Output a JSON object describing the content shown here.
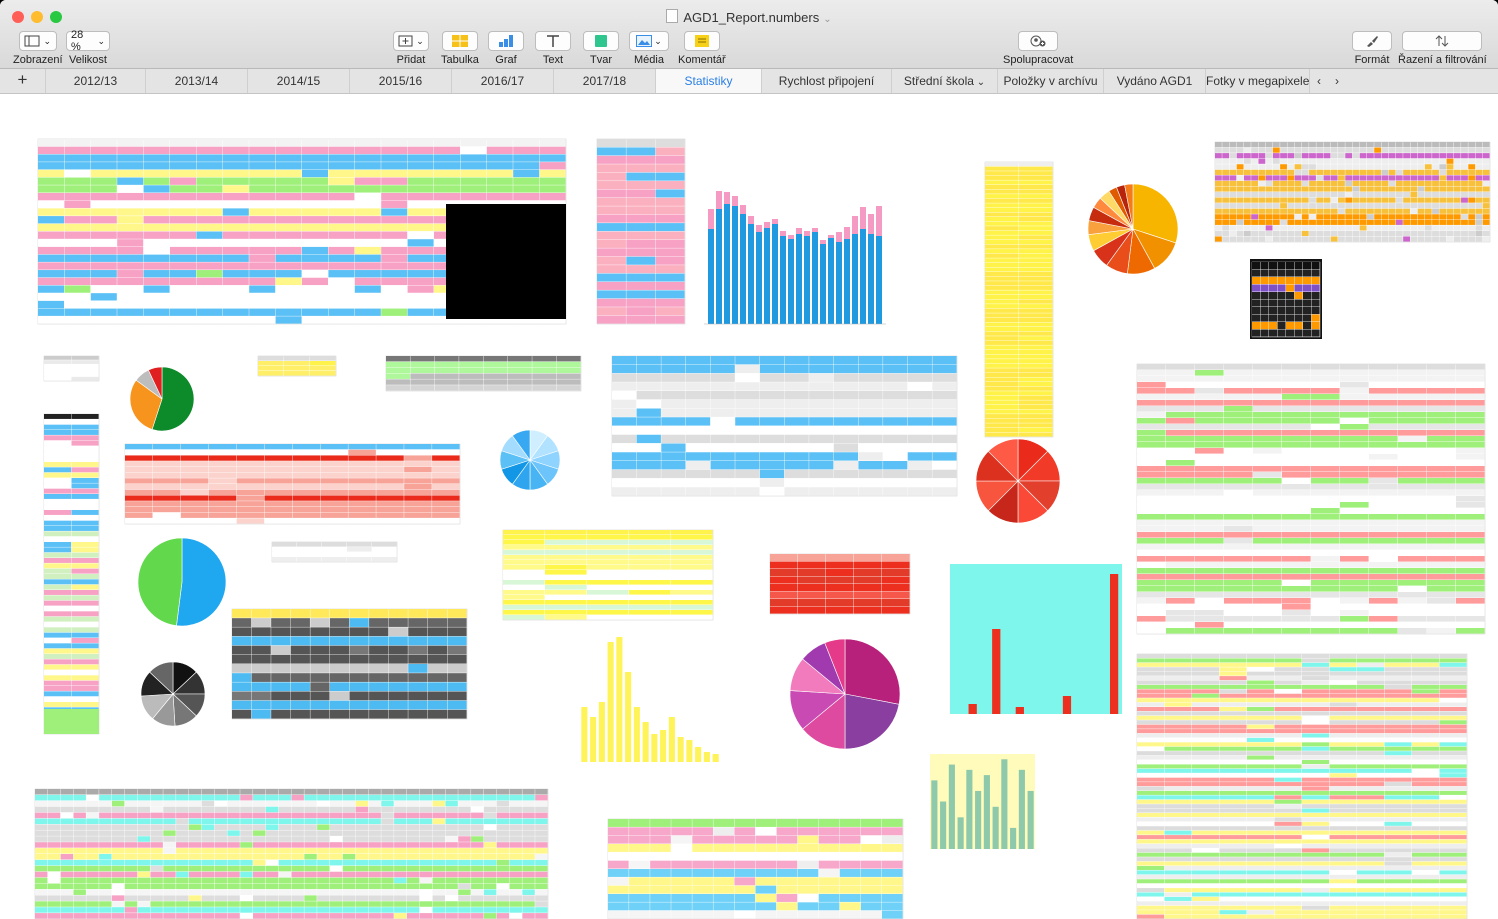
{
  "window": {
    "title": "AGD1_Report.numbers",
    "lights": [
      "#ff5f57",
      "#febc2e",
      "#28c840"
    ]
  },
  "toolbar": {
    "zoom_value": "28 %",
    "view_label": "Zobrazení",
    "size_label": "Velikost",
    "add_label": "Přidat",
    "table_label": "Tabulka",
    "chart_label": "Graf",
    "text_label": "Text",
    "shape_label": "Tvar",
    "media_label": "Média",
    "comment_label": "Komentář",
    "collaborate_label": "Spolupracovat",
    "format_label": "Formát",
    "sort_label": "Řazení a filtrování"
  },
  "sheets": {
    "add": "+",
    "tabs": [
      "2012/13",
      "2013/14",
      "2014/15",
      "2015/16",
      "2016/17",
      "2017/18",
      "Statistiky",
      "Rychlost připojení",
      "Střední škola",
      "Položky v archívu",
      "Vydáno AGD1",
      "Fotky v megapixelech"
    ],
    "active_index": 6
  },
  "colors": {
    "accent": "#2a7fe6",
    "blue": "#5bc0f5",
    "pink": "#f7a1c4",
    "yellow": "#fff78a",
    "green": "#9ff07a",
    "red": "#ec2f1e",
    "cyan": "#7ef6ec",
    "salmon": "#f7a398"
  }
}
